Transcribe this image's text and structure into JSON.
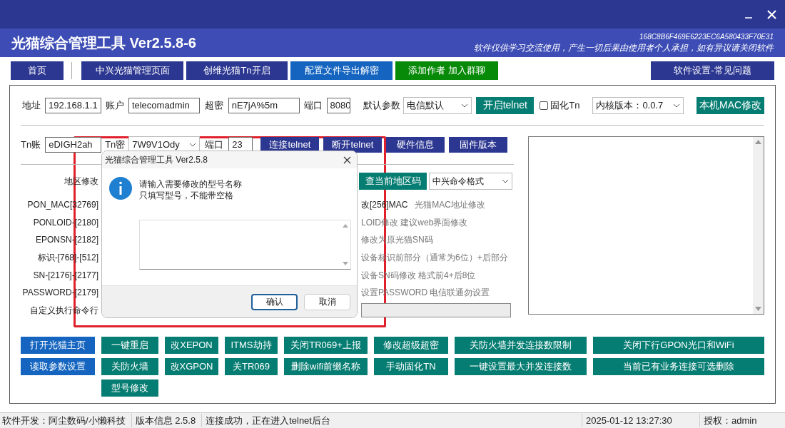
{
  "window": {
    "title": "光猫综合管理工具 Ver2.5.8-6",
    "code": "168C8B6F469E6223EC6A580433F70E31",
    "disclaimer": "软件仅供学习交流使用，产生一切后果由使用者个人承担，如有异议请关闭软件"
  },
  "nav_buttons": [
    {
      "label": "首页",
      "kind": "navy"
    },
    {
      "label": "中兴光猫管理页面",
      "kind": "navy"
    },
    {
      "label": "创维光猫Tn开启",
      "kind": "navy"
    },
    {
      "label": "配置文件导出解密",
      "kind": "blue"
    },
    {
      "label": "添加作者 加入群聊",
      "kind": "green"
    },
    {
      "label": "软件设置-常见问题",
      "kind": "navy"
    }
  ],
  "login_row": {
    "address_label": "地址",
    "address": "192.168.1.1",
    "account_label": "账户",
    "account": "telecomadmin",
    "password_label": "超密",
    "password": "nE7jA%5m",
    "port_label": "端口",
    "port": "8080",
    "defaults_label": "默认参数",
    "defaults": "电信默认",
    "telnet_button": "开启telnet",
    "fix_tn": {
      "label": "固化Tn",
      "checked": false
    },
    "kernel": "内核版本：0.0.7",
    "mac_button": "本机MAC修改"
  },
  "tn_row": {
    "account_label": "Tn账",
    "account": "eDIGH2ah",
    "password_label": "Tn密",
    "password": "7W9V1Ody",
    "port_label": "端口",
    "port": "23",
    "buttons": [
      "连接telnet",
      "断开telnet",
      "硬件信息",
      "固件版本"
    ]
  },
  "settings": [
    {
      "label": "地区修改",
      "kind": "region",
      "button": "查当前地区码",
      "select": "中兴命令格式"
    },
    {
      "label": "PON_MAC[32769]",
      "kind": "note",
      "lead": "改[256]MAC",
      "note": "光猫MAC地址修改"
    },
    {
      "label": "PONLOID-[2180]",
      "kind": "note",
      "note": "LOID修改 建议web界面修改"
    },
    {
      "label": "EPONSN-[2182]",
      "kind": "note",
      "note": "修改为原光猫SN码"
    },
    {
      "label": "标识-[768]-[512]",
      "kind": "note",
      "note": "设备标识前部分（通常为6位）+后部分"
    },
    {
      "label": "SN-[2176]-[2177]",
      "kind": "note",
      "note": "设备SN码修改  格式前4+后8位"
    },
    {
      "label": "PASSWORD-[2179]",
      "kind": "note",
      "note": "设置PASSWORD 电信联通勿设置"
    },
    {
      "label": "自定义执行命令行",
      "kind": "command"
    }
  ],
  "action_columns": [
    [
      {
        "label": "打开光猫主页",
        "kind": "blue"
      },
      {
        "label": "读取参数设置",
        "kind": "blue"
      }
    ],
    [
      {
        "label": "一键重启",
        "kind": "teal"
      },
      {
        "label": "关防火墙",
        "kind": "teal"
      },
      {
        "label": "型号修改",
        "kind": "teal"
      }
    ],
    [
      {
        "label": "改XEPON",
        "kind": "teal"
      },
      {
        "label": "改XGPON",
        "kind": "teal"
      }
    ],
    [
      {
        "label": "ITMS劫持",
        "kind": "teal"
      },
      {
        "label": "关TR069",
        "kind": "teal"
      }
    ],
    [
      {
        "label": "关闭TR069+上报",
        "kind": "teal"
      },
      {
        "label": "删除wifi前缀名称",
        "kind": "teal"
      }
    ],
    [
      {
        "label": "修改超级超密",
        "kind": "teal"
      },
      {
        "label": "手动固化TN",
        "kind": "teal"
      }
    ],
    [
      {
        "label": "关防火墙并发连接数限制",
        "kind": "teal"
      },
      {
        "label": "一键设置最大并发连接数",
        "kind": "teal"
      }
    ],
    [
      {
        "label": "关闭下行GPON光口和WiFi",
        "kind": "teal"
      },
      {
        "label": "当前已有业务连接可选删除",
        "kind": "teal"
      }
    ]
  ],
  "status_bar": [
    "软件开发：阿尘数码/小懒科技",
    "版本信息  2.5.8",
    "连接成功，正在进入telnet后台",
    "2025-01-12 13:27:30",
    "授权：admin"
  ],
  "dialog": {
    "title": "光猫综合管理工具 Ver2.5.8",
    "message_lines": [
      "请输入需要修改的型号名称",
      "只填写型号，不能带空格"
    ],
    "buttons": [
      {
        "label": "确认",
        "focused": true
      },
      {
        "label": "取消",
        "focused": false
      }
    ]
  }
}
